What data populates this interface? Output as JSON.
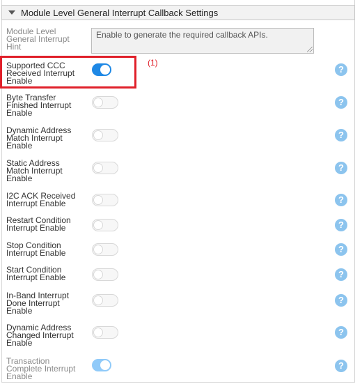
{
  "section": {
    "title": "Module Level General Interrupt Callback Settings"
  },
  "hint": {
    "label": "Module Level General Interrupt Hint",
    "text": "Enable to generate the required callback APIs."
  },
  "annotation": "(1)",
  "help_glyph": "?",
  "colors": {
    "accent": "#1e88e5",
    "highlight": "#e0202a",
    "help": "#8cc4ee"
  },
  "rows": [
    {
      "label": "Supported CCC Received Interrupt Enable",
      "enabled": true,
      "disabled": false
    },
    {
      "label": "Byte Transfer Finished Interrupt Enable",
      "enabled": false,
      "disabled": false
    },
    {
      "label": "Dynamic Address Match Interrupt Enable",
      "enabled": false,
      "disabled": false
    },
    {
      "label": "Static Address Match Interrupt Enable",
      "enabled": false,
      "disabled": false
    },
    {
      "label": "I2C ACK Received Interrupt Enable",
      "enabled": false,
      "disabled": false
    },
    {
      "label": "Restart Condition Interrupt Enable",
      "enabled": false,
      "disabled": false
    },
    {
      "label": "Stop Condition Interrupt Enable",
      "enabled": false,
      "disabled": false
    },
    {
      "label": "Start Condition Interrupt Enable",
      "enabled": false,
      "disabled": false
    },
    {
      "label": "In-Band Interrupt Done Interrupt Enable",
      "enabled": false,
      "disabled": false
    },
    {
      "label": "Dynamic Address Changed Interrupt Enable",
      "enabled": false,
      "disabled": false
    },
    {
      "label": "Transaction Complete Interrupt Enable",
      "enabled": true,
      "disabled": true
    }
  ]
}
